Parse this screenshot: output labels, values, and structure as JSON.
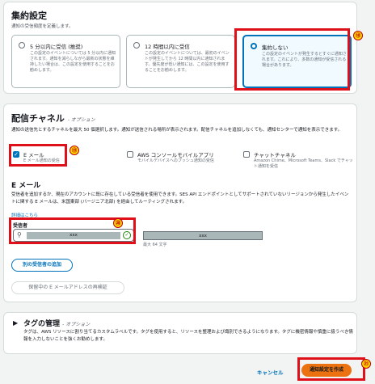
{
  "frequency": {
    "title": "集約設定",
    "subtitle": "通知の受信頻度を定義します。",
    "options": [
      {
        "label": "5 分以内に受信 (推奨)",
        "desc": "この設定のイベントについては 5 分以内に通知されます。通知を減らしながら最新の状態を維持したい場合は、この設定を使用することをお勧めします。"
      },
      {
        "label": "12 時間以内に受信",
        "desc": "この設定のイベントについては、最初のイベントが発生してから 12 時間以内に通知されます。優先度が低い通知には、この設定を使用することをお勧めします。"
      },
      {
        "label": "集約しない",
        "desc": "この設定のイベントが発生するとすぐに通知されます。これにより、多数の通知が受信される場合があります。"
      }
    ],
    "callout": "⑱"
  },
  "channels": {
    "title": "配信チャネル",
    "optional": "- オプション",
    "description": "通知の送信先とするチャネルを最大 50 個選択します。通知が送信される場所が表示されます。配信チャネルを追加しなくても、通知センターで通知を表示できます。",
    "items": [
      {
        "label": "E メール",
        "desc": "E メール通知の受信",
        "checked": true
      },
      {
        "label": "AWS コンソールモバイルアプリ",
        "desc": "モバイルデバイスへのプッシュ通知の受信",
        "checked": false
      },
      {
        "label": "チャットチャネル",
        "desc": "Amazon Chime、Microsoft Teams、Slack でチャット通知を受信",
        "checked": false
      }
    ],
    "callout": "⑲"
  },
  "email": {
    "title": "E メール",
    "description": "受信者を追加するか、現在のアカウントに既に存在している受信者を使用できます。SES API エンドポイントとしてサポートされていないリージョンから発生したイベントに関する E メールは、米国東部 (バージニア北部) を経由してルーティングされます。",
    "learn_more": "詳細はこちら",
    "recipients_label": "受信者",
    "recipient_value": "xxx",
    "token_value": "xxx",
    "max_chars": "最大 64 文字",
    "add_button": "別の受信者の追加",
    "resend_button": "保留中の E メールアドレスの再検証",
    "callout": "⑳"
  },
  "tags": {
    "title": "タグの管理",
    "optional": "- オプション",
    "description": "タグは、AWS リソースに割り当てるカスタムラベルです。タグを使用すると、リソースを整理および識別できるようになります。タグに機密情報や慎重に扱うべき情報を入力しないことを強くお勧めします。"
  },
  "footer": {
    "cancel": "キャンセル",
    "create": "通知設定を作成",
    "callout": "㉑"
  },
  "colors": {
    "accent": "#0073bb",
    "highlight": "#e0101a",
    "primary_button": "#ec7211"
  }
}
